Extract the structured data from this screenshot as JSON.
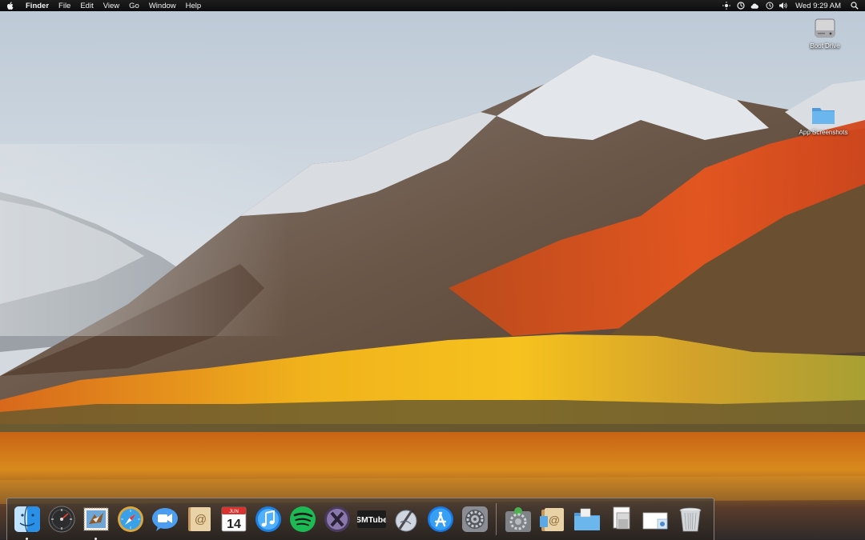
{
  "menubar": {
    "apple_icon": "apple-icon",
    "app_name": "Finder",
    "menus": [
      "File",
      "Edit",
      "View",
      "Go",
      "Window",
      "Help"
    ],
    "status_icons": [
      "brightness-icon",
      "time-machine-icon",
      "creative-cloud-icon",
      "history-icon",
      "volume-icon"
    ],
    "clock": "Wed 9:29 AM",
    "search_icon": "spotlight-search-icon"
  },
  "desktop": {
    "icons": [
      {
        "label": "Boot Drive",
        "icon": "hard-drive-icon"
      },
      {
        "label": "App Screenshots",
        "icon": "folder-icon"
      }
    ]
  },
  "dock": {
    "apps": [
      {
        "name": "Finder",
        "running": true
      },
      {
        "name": "Dashboard",
        "running": false
      },
      {
        "name": "Mail",
        "running": true
      },
      {
        "name": "Safari",
        "running": false
      },
      {
        "name": "FaceTime",
        "running": false
      },
      {
        "name": "Contacts",
        "running": false
      },
      {
        "name": "Calendar",
        "running": false,
        "month": "JUN",
        "day": "14"
      },
      {
        "name": "iTunes",
        "running": false
      },
      {
        "name": "Spotify",
        "running": false
      },
      {
        "name": "macOS X",
        "running": false
      },
      {
        "name": "SMTube",
        "running": false,
        "text": "SMTube"
      },
      {
        "name": "Script Editor",
        "running": false
      },
      {
        "name": "App Store",
        "running": false
      },
      {
        "name": "System Preferences",
        "running": false
      }
    ],
    "stacks": [
      {
        "name": "System Preferences Folder"
      },
      {
        "name": "Mail Documents"
      },
      {
        "name": "Applications"
      },
      {
        "name": "Documents"
      },
      {
        "name": "Downloads"
      },
      {
        "name": "Trash"
      }
    ]
  },
  "colors": {
    "menubar": "#111111",
    "folder_blue": "#5aa9e6",
    "spotify_green": "#1db954"
  }
}
